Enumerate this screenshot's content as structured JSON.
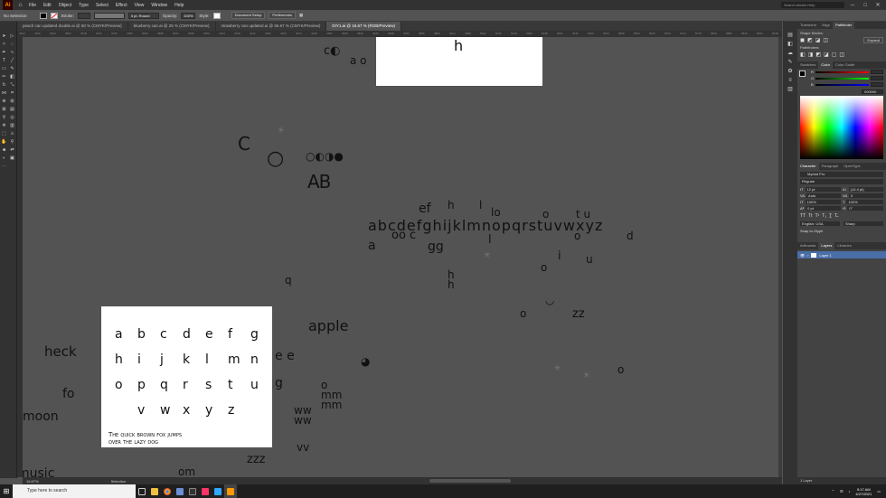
{
  "menubar": {
    "items": [
      "File",
      "Edit",
      "Object",
      "Type",
      "Select",
      "Effect",
      "View",
      "Window",
      "Help"
    ],
    "search_placeholder": "Search Adobe Help"
  },
  "control_bar": {
    "selection_label": "No Selection",
    "stroke_label": "Stroke:",
    "stroke_profile": "3 pt. Round",
    "opacity_label": "Opacity:",
    "opacity_value": "100%",
    "style_label": "Style:",
    "document_setup": "Document Setup",
    "preferences": "Preferences"
  },
  "tabs": [
    {
      "label": "peach can updated double.ai @ 50 % (CMYK/Preview)",
      "active": false
    },
    {
      "label": "blueberry can.ai @ 25 % (CMYK/Preview)",
      "active": false
    },
    {
      "label": "strawberry can updated.ai @ 66.67 % (CMYK/Preview)",
      "active": false
    },
    {
      "label": "DIY1.ai @ 16.67 % (RGB/Preview)",
      "active": true
    }
  ],
  "ruler_marks": [
    "3402",
    "3456",
    "3510",
    "3564",
    "3618",
    "3672",
    "3726",
    "3780",
    "3834",
    "3888",
    "3942",
    "3996",
    "4050",
    "4104",
    "4158",
    "4212",
    "4266",
    "4320",
    "4374",
    "4428",
    "4482",
    "4536",
    "4590",
    "4644",
    "4698",
    "4752",
    "4806",
    "4860",
    "4914",
    "4968",
    "5022",
    "5076",
    "5130",
    "5184",
    "5238",
    "5292",
    "5346",
    "5400",
    "5454",
    "5508",
    "5562",
    "5616",
    "5670",
    "5724",
    "5778",
    "5832",
    "5886",
    "5940",
    "5994",
    "6048"
  ],
  "canvas": {
    "top_artboard_letter": "h",
    "glyphs_small": [
      "C",
      "O",
      "O",
      "O",
      "O",
      "AB",
      "a",
      "o",
      "c",
      "g",
      "g"
    ],
    "alphabet_line": "abcdefghijklmnopqrstuvwxyz",
    "apple_word": "apple",
    "heck_word": "heck",
    "fo_word": "fo",
    "moon_word": "moon",
    "music_word": "music",
    "zz_word": "zz",
    "zzz_word": "zzz",
    "main_artboard": {
      "rows": [
        [
          "a",
          "b",
          "c",
          "d",
          "e",
          "f",
          "g"
        ],
        [
          "h",
          "i",
          "j",
          "k",
          "l",
          "m",
          "n"
        ],
        [
          "o",
          "p",
          "q",
          "r",
          "s",
          "t",
          "u"
        ],
        [
          "v",
          "w",
          "x",
          "y",
          "z"
        ]
      ],
      "pangram_line1": "The quick brown fox jumps",
      "pangram_line2": "over the lazy dog"
    }
  },
  "status_bar": {
    "zoom": "16.67%",
    "tool": "Selection"
  },
  "panels": {
    "top_tabs": [
      "Transform",
      "Align",
      "Pathfinder"
    ],
    "shape_modes_label": "Shape Modes:",
    "expand_label": "Expand",
    "pathfinders_label": "Pathfinders:",
    "color_tabs": [
      "Swatches",
      "Color",
      "Color Guide"
    ],
    "rgb_labels": [
      "R",
      "G",
      "B"
    ],
    "hex_value": "000000",
    "character_tabs": [
      "Character",
      "Paragraph",
      "OpenType"
    ],
    "font_search": "Myriad Pro",
    "font_style": "Regular",
    "font_size": "12 pt",
    "leading": "(14.4 pt)",
    "kerning": "Auto",
    "tracking": "0",
    "scale_h": "100%",
    "scale_v": "100%",
    "baseline": "0 pt",
    "rotation": "0°",
    "language": "English: USA",
    "antialias": "Sharp",
    "snap_label": "Snap to Glyph",
    "layer_tabs": [
      "Artboards",
      "Layers",
      "Libraries"
    ],
    "layer_name": "Layer 1",
    "layer_count": "1 Layer"
  },
  "taskbar": {
    "search_placeholder": "Type here to search",
    "time": "5:17 AM",
    "date": "4/27/2021"
  },
  "colors": {
    "accent": "#2d8ceb",
    "ai_orange": "#ff9a00"
  }
}
